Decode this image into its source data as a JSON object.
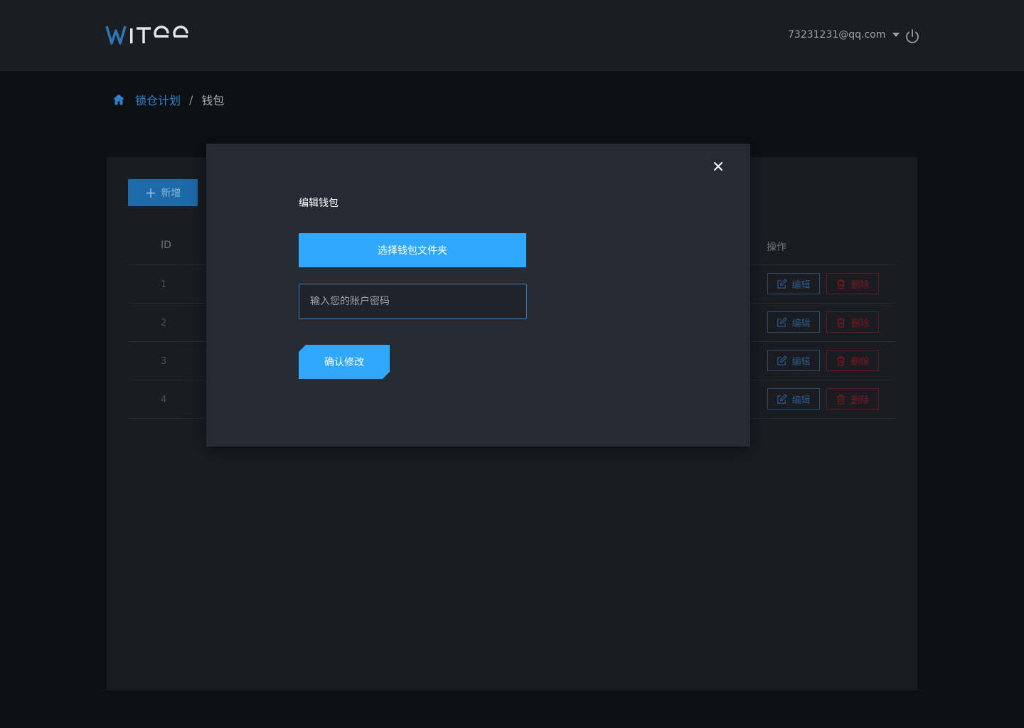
{
  "header": {
    "logo_text": "WITee",
    "user_email": "73231231@qq.com"
  },
  "breadcrumb": {
    "link": "锁仓计划",
    "separator": "/",
    "current": "钱包"
  },
  "panel": {
    "add_button": "新增",
    "columns": {
      "id": "ID",
      "actions": "操作"
    },
    "rows": [
      {
        "id": "1",
        "edit": "编辑",
        "delete": "删除"
      },
      {
        "id": "2",
        "edit": "编辑",
        "delete": "删除"
      },
      {
        "id": "3",
        "edit": "编辑",
        "delete": "删除"
      },
      {
        "id": "4",
        "edit": "编辑",
        "delete": "删除"
      }
    ]
  },
  "modal": {
    "title": "编辑钱包",
    "select_folder_button": "选择钱包文件夹",
    "password_placeholder": "输入您的账户密码",
    "password_value": "",
    "confirm_button": "确认修改"
  },
  "colors": {
    "accent": "#31a8ff",
    "link": "#2f80c9",
    "danger": "#7a1a1c"
  }
}
